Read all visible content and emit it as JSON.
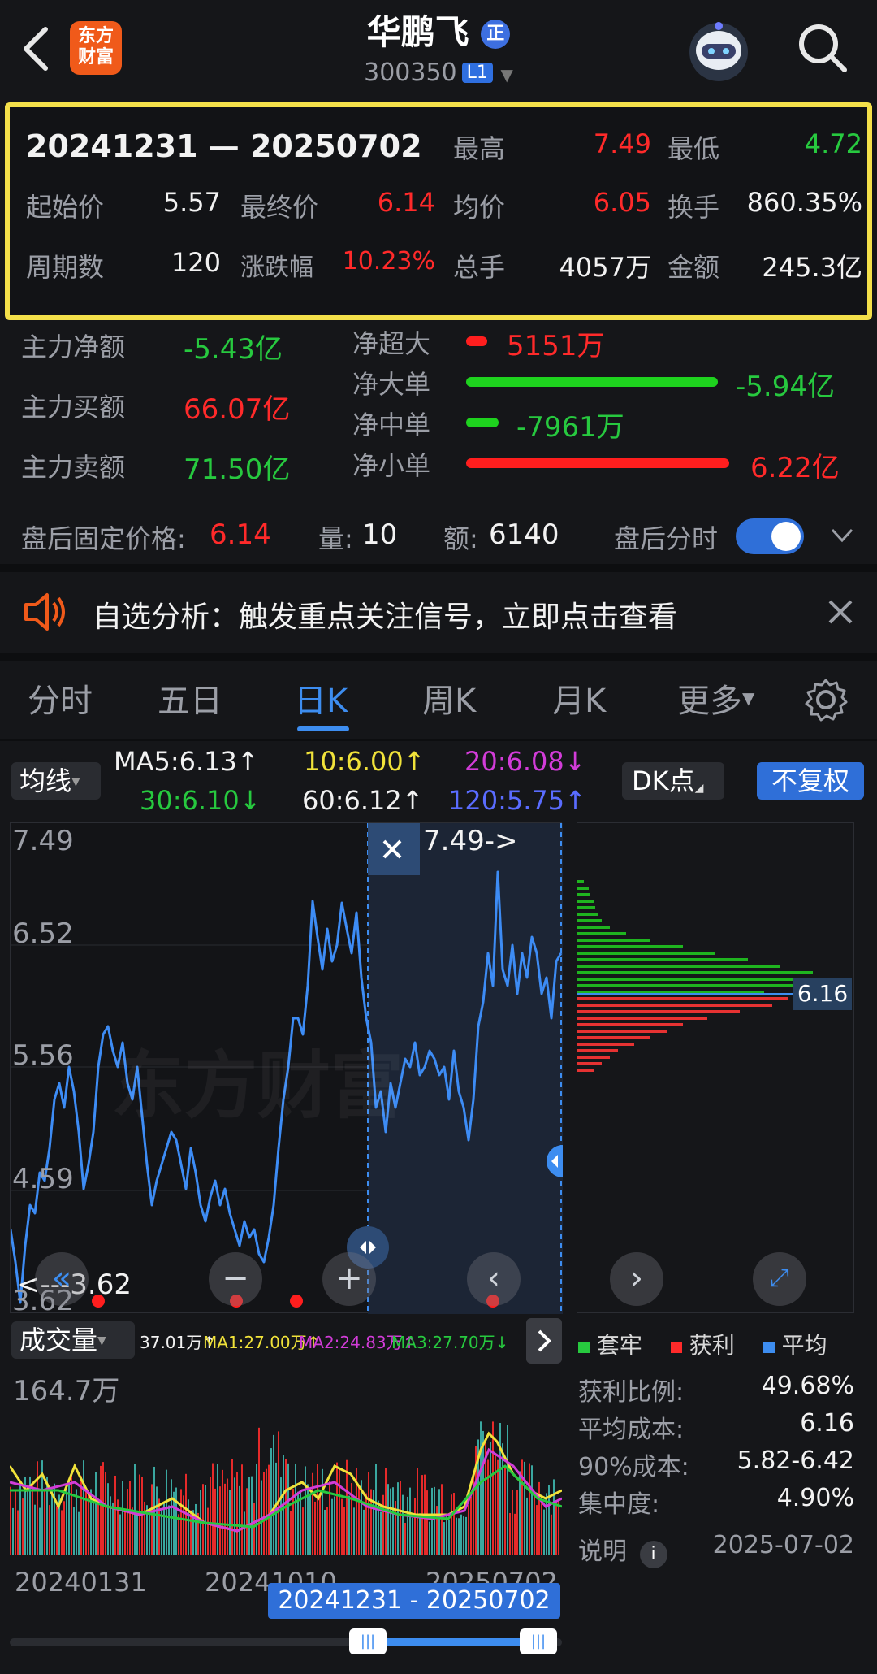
{
  "header": {
    "logo_text": "东方\n财富",
    "stock_name": "华鹏飞",
    "stock_badge": "正",
    "stock_code": "300350",
    "level": "L1"
  },
  "summary": {
    "range": "20241231 — 20250702",
    "high_label": "最高",
    "high": "7.49",
    "low_label": "最低",
    "low": "4.72",
    "start_label": "起始价",
    "start": "5.57",
    "end_label": "最终价",
    "end": "6.14",
    "avg_label": "均价",
    "avg": "6.05",
    "turnover_label": "换手",
    "turnover": "860.35%",
    "periods_label": "周期数",
    "periods": "120",
    "change_label": "涨跌幅",
    "change": "10.23%",
    "volume_label": "总手",
    "volume": "4057万",
    "amount_label": "金额",
    "amount": "245.3亿"
  },
  "fund_flow": {
    "net_label": "主力净额",
    "net": "-5.43亿",
    "buy_label": "主力买额",
    "buy": "66.07亿",
    "sell_label": "主力卖额",
    "sell": "71.50亿",
    "super_label": "净超大",
    "super": "5151万",
    "large_label": "净大单",
    "large": "-5.94亿",
    "medium_label": "净中单",
    "medium": "-7961万",
    "small_label": "净小单",
    "small": "6.22亿"
  },
  "after_hours": {
    "price_label": "盘后固定价格:",
    "price": "6.14",
    "qty_label": "量:",
    "qty": "10",
    "amt_label": "额:",
    "amt": "6140",
    "toggle_label": "盘后分时"
  },
  "notice": {
    "text": "自选分析：触发重点关注信号，立即点击查看"
  },
  "tabs": {
    "t1": "分时",
    "t2": "五日",
    "t3": "日K",
    "t4": "周K",
    "t5": "月K",
    "t6": "更多"
  },
  "ma": {
    "selector": "均线",
    "ma5": "MA5:6.13↑",
    "ma10": "10:6.00↑",
    "ma20": "20:6.08↓",
    "ma30": "30:6.10↓",
    "ma60": "60:6.12↑",
    "ma120": "120:5.75↑",
    "dk": "DK点",
    "adjust": "不复权"
  },
  "price_chart": {
    "y_labels": {
      "y1": "7.49",
      "y2": "6.52",
      "y3": "5.56",
      "y4": "4.59",
      "y5": "3.62"
    },
    "high_marker": "7.49->",
    "low_marker": "<---3.62",
    "dist_price": "6.16",
    "watermark": "东方财富"
  },
  "volume": {
    "selector": "成交量",
    "vol": "37.01万↑",
    "ma1": "MA1:27.00万↑",
    "ma2": "MA2:24.83万↑",
    "ma3": "MA3:27.70万↓",
    "max_label": "164.7万",
    "x1": "20240131",
    "x2": "20241010",
    "x3": "20250702",
    "selection": "20241231 - 20250702"
  },
  "chip": {
    "legend_trapped": "套牢",
    "legend_profit": "获利",
    "legend_avg": "平均",
    "profit_ratio_label": "获利比例:",
    "profit_ratio": "49.68%",
    "avg_cost_label": "平均成本:",
    "avg_cost": "6.16",
    "cost90_label": "90%成本:",
    "cost90": "5.82-6.42",
    "concentration_label": "集中度:",
    "concentration": "4.90%",
    "note_label": "说明",
    "date": "2025-07-02"
  },
  "colors": {
    "up": "#ff2a2a",
    "down": "#27c93f",
    "accent": "#3d8df0",
    "highlight": "#f4e04a"
  }
}
